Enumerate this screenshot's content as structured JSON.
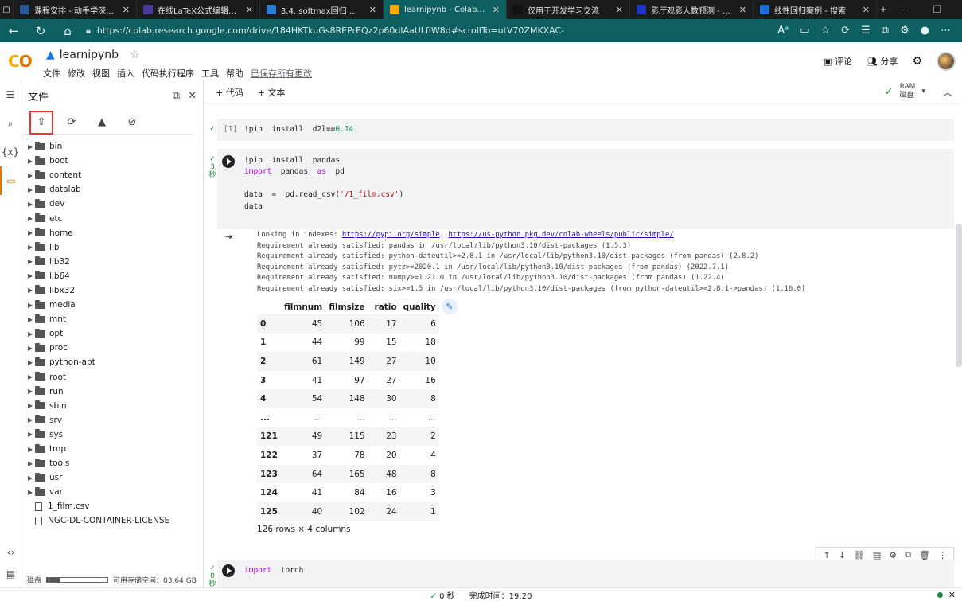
{
  "browser": {
    "tabs": [
      {
        "label": "课程安排 - 动手学深度学",
        "color": "#2b5797"
      },
      {
        "label": "在线LaTeX公式编辑器-编",
        "color": "#4a3aa0"
      },
      {
        "label": "3.4. softmax回归 — 动手",
        "color": "#2a7fd4"
      },
      {
        "label": "learnipynb - Colaborator",
        "color": "#f9ab00"
      },
      {
        "label": "仅用于开发学习交流",
        "color": "#111111"
      },
      {
        "label": "影厅观影人数预测 - 飞桨",
        "color": "#2032c8"
      },
      {
        "label": "线性回归案例 - 搜索",
        "color": "#1b6ed6"
      }
    ],
    "url": "https://colab.research.google.com/drive/184HKTkuGs8REPrEQz2p60dlAaULfiW8d#scrollTo=utV70ZMKXAC-"
  },
  "app": {
    "notebook_name": "learnipynb",
    "menu": [
      "文件",
      "修改",
      "视图",
      "插入",
      "代码执行程序",
      "工具",
      "帮助"
    ],
    "saved_status": "已保存所有更改",
    "comment": "评论",
    "share": "分享"
  },
  "files_panel": {
    "title": "文件",
    "folders": [
      "bin",
      "boot",
      "content",
      "datalab",
      "dev",
      "etc",
      "home",
      "lib",
      "lib32",
      "lib64",
      "libx32",
      "media",
      "mnt",
      "opt",
      "proc",
      "python-apt",
      "root",
      "run",
      "sbin",
      "srv",
      "sys",
      "tmp",
      "tools",
      "usr",
      "var"
    ],
    "files": [
      "1_film.csv",
      "NGC-DL-CONTAINER-LICENSE"
    ],
    "disk_label": "磁盘",
    "disk_free": "可用存储空间：83.64 GB",
    "disk_used_fraction": 0.22
  },
  "toolbar": {
    "add_code": "+ 代码",
    "add_text": "+ 文本",
    "ram": "RAM",
    "disk": "磁盘"
  },
  "cells": {
    "cell1": {
      "exec_count": "[1]",
      "cmd": "!pip  install  d2l==",
      "version": "0.14."
    },
    "cell2": {
      "duration": "3",
      "unit": "秒",
      "line1": "!pip  install  pandas",
      "line2_kw1": "import",
      "line2_mid": "  pandas  ",
      "line2_kw2": "as",
      "line2_end": "  pd",
      "line4_a": "data  =  pd.read_csv(",
      "line4_str": "'/1_film.csv'",
      "line4_b": ")",
      "line5": "data"
    },
    "cell3": {
      "duration": "0",
      "unit": "秒",
      "kw": "import",
      "rest": "  torch"
    }
  },
  "output": {
    "looking_prefix": "Looking in indexes: ",
    "link1": "https://pypi.org/simple",
    "sep": ", ",
    "link2": "https://us-python.pkg.dev/colab-wheels/public/simple/",
    "requirements": [
      "Requirement already satisfied: pandas in /usr/local/lib/python3.10/dist-packages (1.5.3)",
      "Requirement already satisfied: python-dateutil>=2.8.1 in /usr/local/lib/python3.10/dist-packages (from pandas) (2.8.2)",
      "Requirement already satisfied: pytz>=2020.1 in /usr/local/lib/python3.10/dist-packages (from pandas) (2022.7.1)",
      "Requirement already satisfied: numpy>=1.21.0 in /usr/local/lib/python3.10/dist-packages (from pandas) (1.22.4)",
      "Requirement already satisfied: six>=1.5 in /usr/local/lib/python3.10/dist-packages (from python-dateutil>=2.8.1->pandas) (1.16.0)"
    ],
    "table": {
      "columns": [
        "filmnum",
        "filmsize",
        "ratio",
        "quality"
      ],
      "rows": [
        [
          "0",
          "45",
          "106",
          "17",
          "6"
        ],
        [
          "1",
          "44",
          "99",
          "15",
          "18"
        ],
        [
          "2",
          "61",
          "149",
          "27",
          "10"
        ],
        [
          "3",
          "41",
          "97",
          "27",
          "16"
        ],
        [
          "4",
          "54",
          "148",
          "30",
          "8"
        ],
        [
          "...",
          "...",
          "...",
          "...",
          "..."
        ],
        [
          "121",
          "49",
          "115",
          "23",
          "2"
        ],
        [
          "122",
          "37",
          "78",
          "20",
          "4"
        ],
        [
          "123",
          "64",
          "165",
          "48",
          "8"
        ],
        [
          "124",
          "41",
          "84",
          "16",
          "3"
        ],
        [
          "125",
          "40",
          "102",
          "24",
          "1"
        ]
      ]
    },
    "shape": "126 rows × 4 columns"
  },
  "status": {
    "check": "0 秒",
    "done": "完成时间：19:20"
  }
}
